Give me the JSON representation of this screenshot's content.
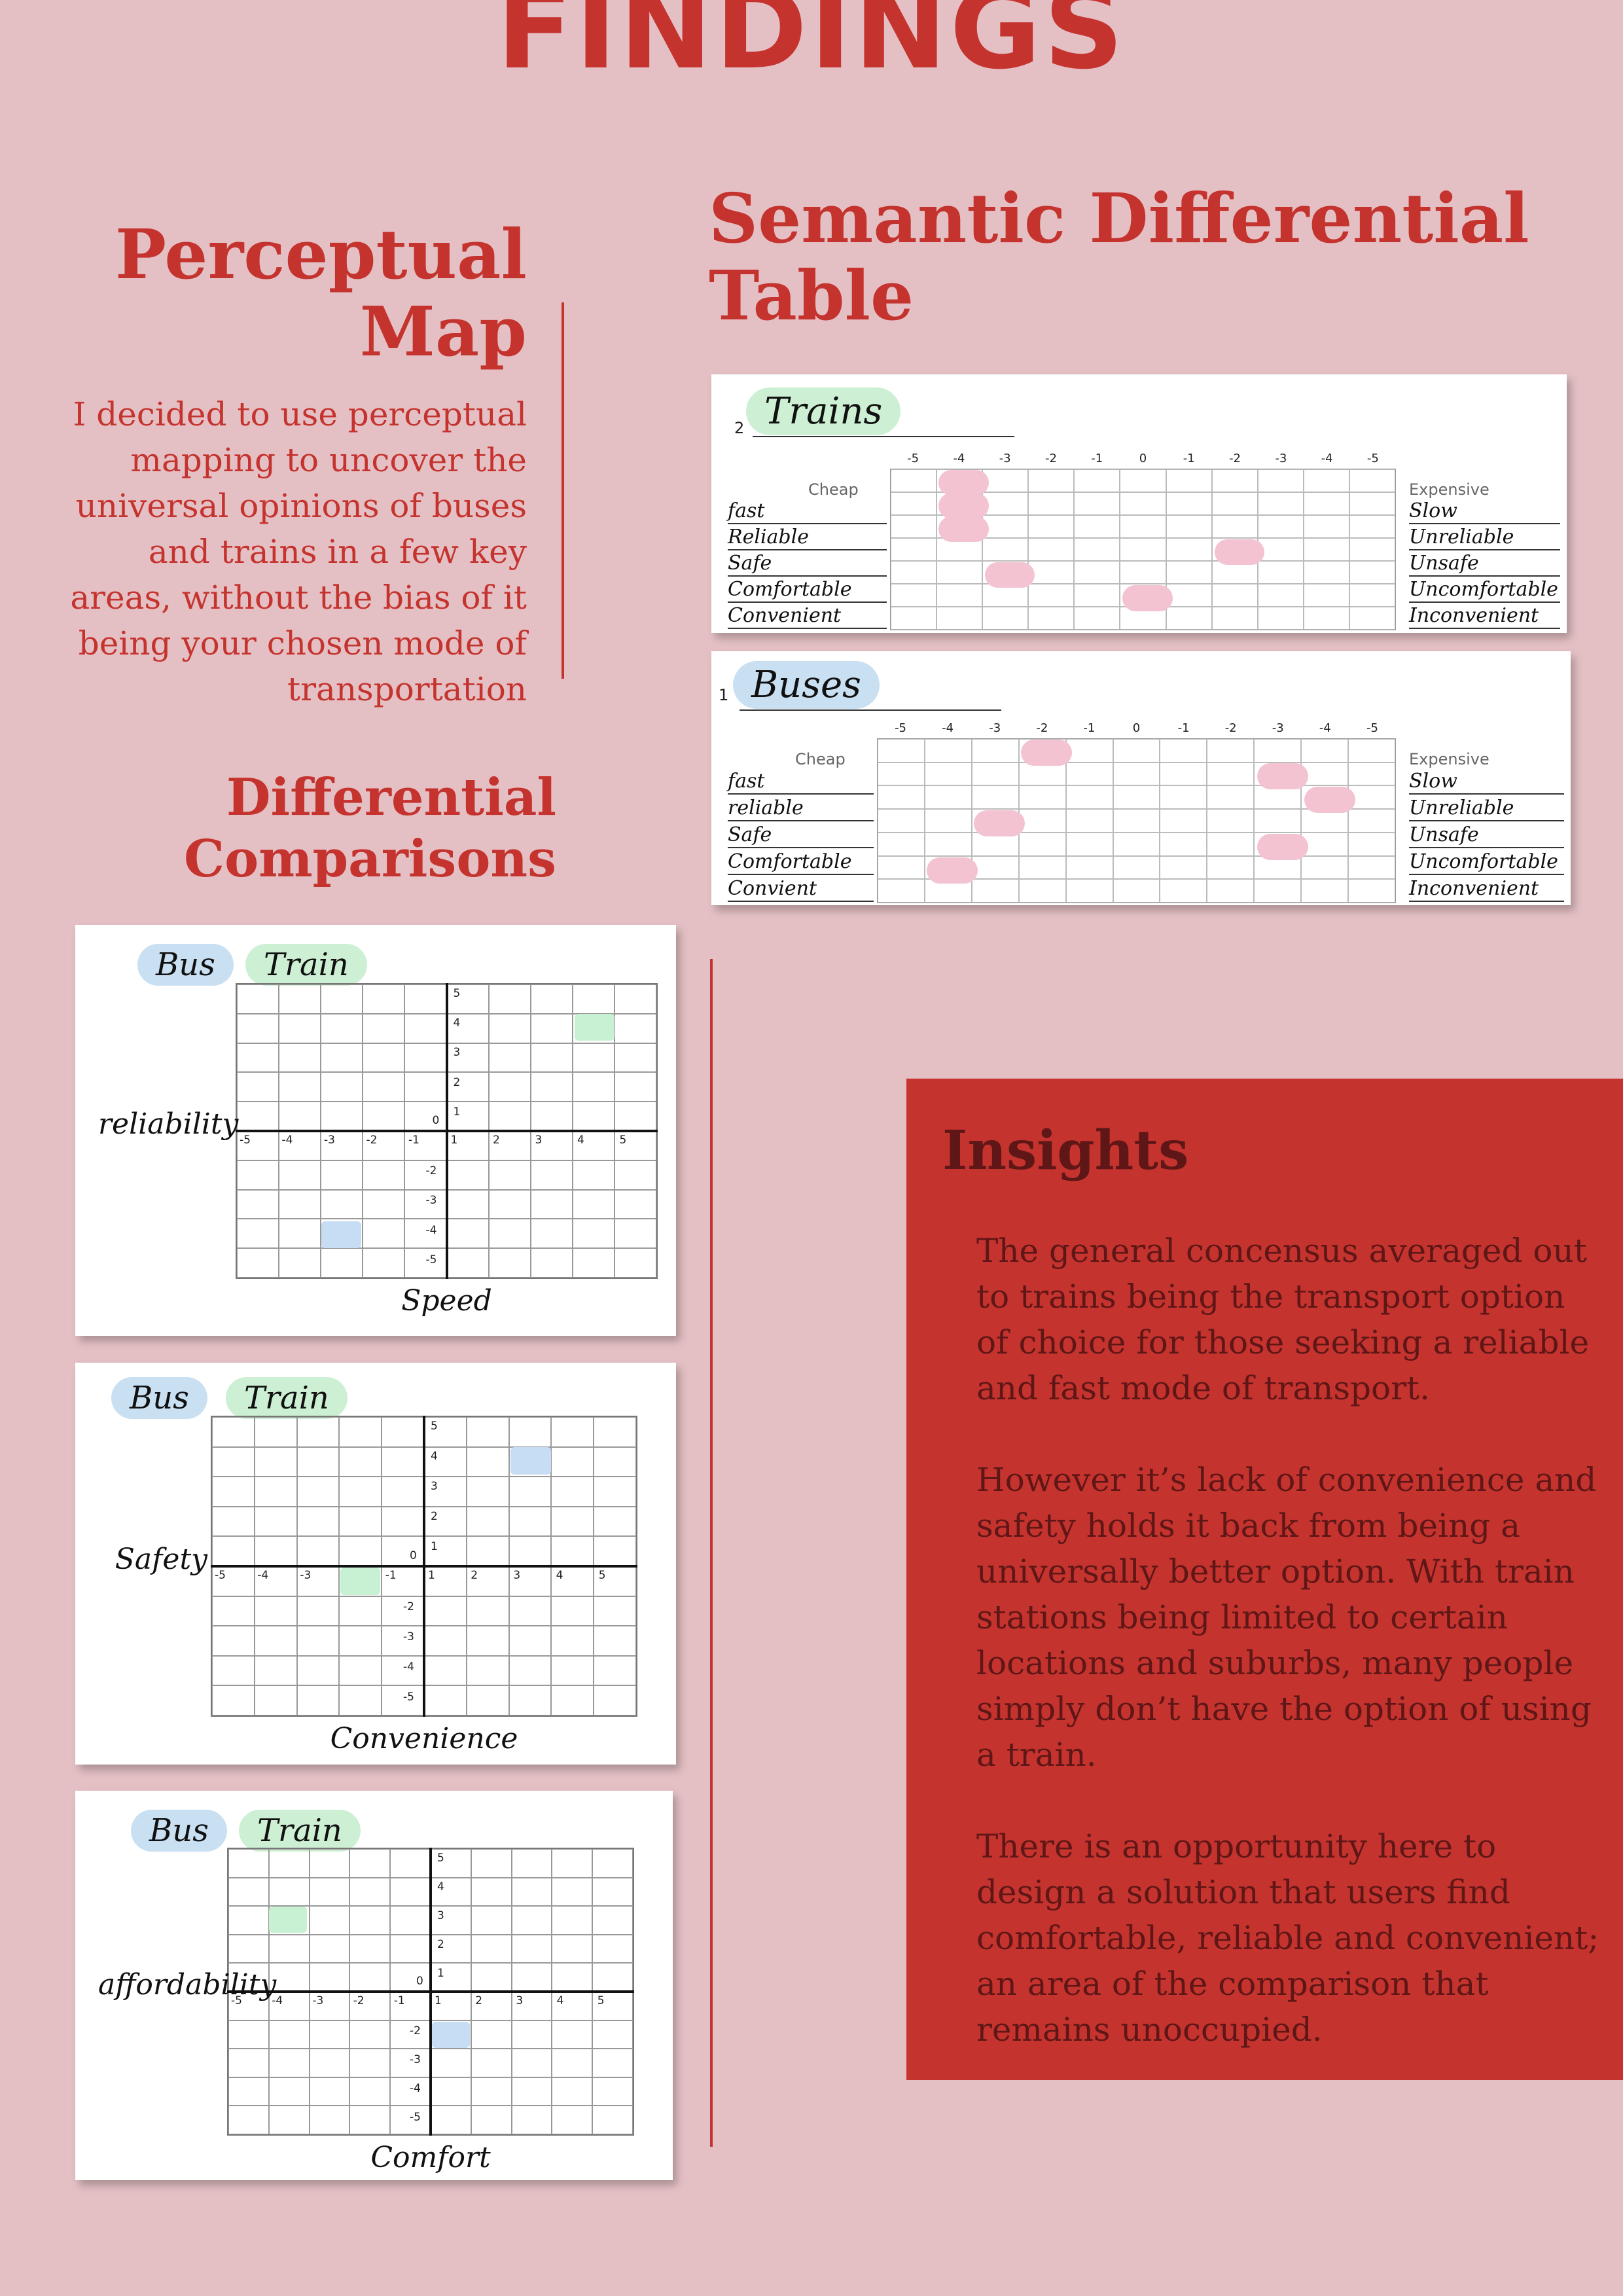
{
  "page": {
    "title": "FINDINGS"
  },
  "perceptual_map": {
    "title_line1": "Perceptual",
    "title_line2": "Map",
    "body": "I decided to use perceptual mapping to uncover the universal opinions of buses and trains in a few key areas, without the bias of it being your chosen mode of transportation"
  },
  "differential_comparisons": {
    "title_line1": "Differential",
    "title_line2": "Comparisons",
    "legend_bus": "Bus",
    "legend_train": "Train",
    "maps": [
      {
        "y_label": "reliability",
        "x_label": "Speed",
        "bus": [
          -3,
          -4
        ],
        "train": [
          4,
          4
        ]
      },
      {
        "y_label": "Safety",
        "x_label": "Convenience",
        "bus": [
          3,
          4
        ],
        "train": [
          -2,
          -1
        ]
      },
      {
        "y_label": "affordability",
        "x_label": "Comfort",
        "bus": [
          1,
          -2
        ],
        "train": [
          -4,
          3
        ]
      }
    ],
    "x_ticks": [
      "-5",
      "-4",
      "-3",
      "-2",
      "-1",
      "1",
      "2",
      "3",
      "4",
      "5"
    ],
    "y_ticks_pos": [
      "5",
      "4",
      "3",
      "2",
      "1"
    ],
    "y_ticks_neg": [
      "-2",
      "-3",
      "-4",
      "-5"
    ],
    "origin": "0"
  },
  "semantic_differential": {
    "title_line1": "Semantic Differential",
    "title_line2": "Table",
    "col_headers": [
      "-5",
      "-4",
      "-3",
      "-2",
      "-1",
      "0",
      "-1",
      "-2",
      "-3",
      "-4",
      "-5"
    ],
    "left_head": "Cheap",
    "right_head": "Expensive",
    "tables": [
      {
        "index": "2",
        "name": "Trains",
        "left": [
          "fast",
          "Reliable",
          "Safe",
          "Comfortable",
          "Convenient"
        ],
        "right": [
          "Slow",
          "Unreliable",
          "Unsafe",
          "Uncomfortable",
          "Inconvenient"
        ],
        "marks_col": [
          1,
          1,
          1,
          7,
          2,
          5
        ],
        "marks_row": [
          0,
          1,
          2,
          3,
          4,
          5
        ]
      },
      {
        "index": "1",
        "name": "Buses",
        "left": [
          "fast",
          "reliable",
          "Safe",
          "Comfortable",
          "Convient"
        ],
        "right": [
          "Slow",
          "Unreliable",
          "Unsafe",
          "Uncomfortable",
          "Inconvenient"
        ],
        "marks_col": [
          3,
          8,
          9,
          2,
          8,
          1
        ],
        "marks_row": [
          0,
          1,
          2,
          3,
          4,
          5
        ]
      }
    ]
  },
  "insights": {
    "title": "Insights",
    "p1": "The general concensus averaged out to trains being the transport option of choice for those seeking a reliable and fast mode of transport.",
    "p2": "However it’s lack of convenience and safety holds it back from being a universally better option. With train stations being limited to certain locations and suburbs, many people simply don’t have the option of using a train.",
    "p3": "There is an opportunity here to design a solution that users find comfortable, reliable and convenient; an area of the comparison that remains unoccupied."
  },
  "colors": {
    "background": "#e4c0c4",
    "accent": "#c5332e",
    "insight_text": "#5e1616",
    "bus": "#c7ddf4",
    "train": "#c8f0d2",
    "mark": "#f3c3d2"
  }
}
